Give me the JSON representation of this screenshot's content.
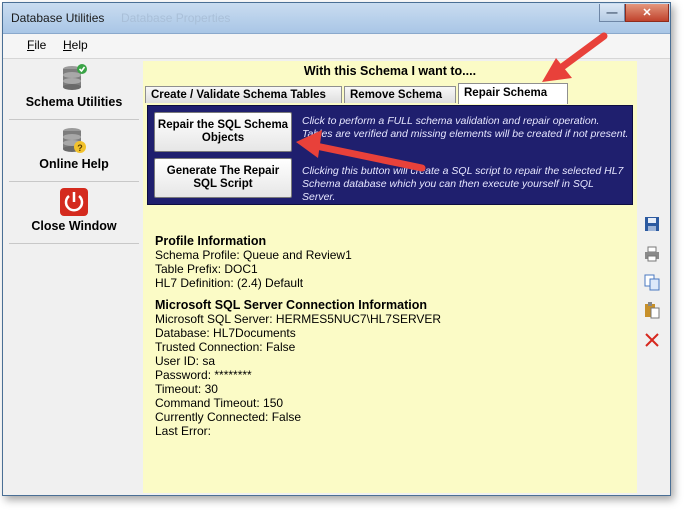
{
  "window": {
    "title": "Database Utilities",
    "ghost_title": "Database Properties"
  },
  "menu": {
    "file": "File",
    "help": "Help"
  },
  "sidebar": [
    {
      "label": "Schema Utilities",
      "icon": "database-check-icon"
    },
    {
      "label": "Online Help",
      "icon": "database-help-icon"
    },
    {
      "label": "Close Window",
      "icon": "power-icon"
    }
  ],
  "banner": "With this Schema I want to....",
  "tabs": [
    "Create / Validate Schema Tables",
    "Remove Schema",
    "Repair Schema"
  ],
  "active_tab": "Repair Schema",
  "actions": {
    "repair_label": "Repair the SQL Schema Objects",
    "repair_desc": "Click to perform a FULL schema validation and repair operation. Tables are verified and missing elements will be created if not present.",
    "generate_label": "Generate The Repair SQL Script",
    "generate_desc": "Clicking this button will create a SQL script to repair the selected HL7 Schema database which you can then execute yourself in SQL Server."
  },
  "profile": {
    "heading": "Profile Information",
    "lines": [
      "Schema Profile: Queue and Review1",
      "Table Prefix: DOC1",
      "HL7 Definition: (2.4) Default"
    ]
  },
  "connection": {
    "heading": "Microsoft SQL Server Connection Information",
    "lines": [
      "Microsoft SQL Server: HERMES5NUC7\\HL7SERVER",
      "Database: HL7Documents",
      "Trusted Connection: False",
      "User ID: sa",
      "Password: ********",
      "Timeout: 30",
      "Command Timeout: 150",
      "Currently Connected: False",
      "Last Error:"
    ]
  },
  "toolstrip": [
    "save-icon",
    "print-icon",
    "copy-icon",
    "paste-icon",
    "delete-icon"
  ],
  "colors": {
    "panel": "#1f1f6e",
    "content_bg": "#fbfbc6",
    "annotation_arrow": "#e8413a"
  }
}
